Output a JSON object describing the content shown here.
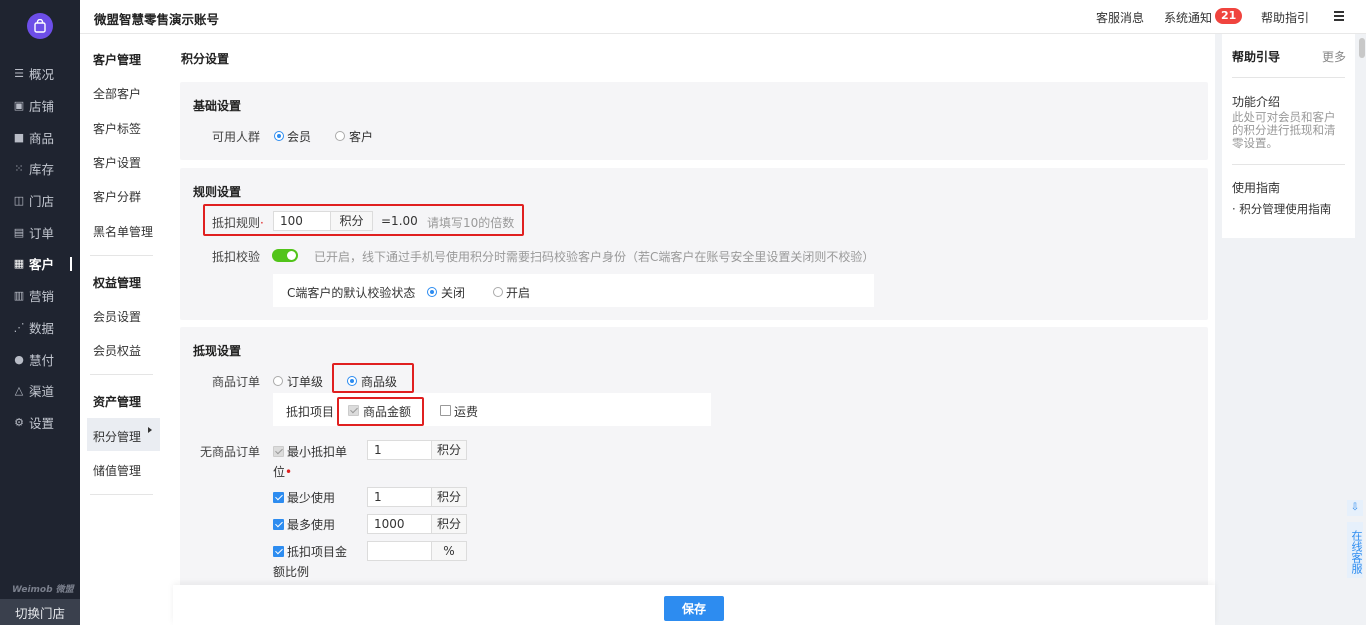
{
  "app": {
    "store_name": "微盟智慧零售演示账号",
    "brand": "Weimob 微盟",
    "switch_store": "切换门店"
  },
  "header": {
    "service_msg": "客服消息",
    "sys_notice": "系统通知",
    "notice_count": "21",
    "help_guide": "帮助指引"
  },
  "nav": {
    "items": [
      {
        "label": "概况",
        "icon": "list-icon"
      },
      {
        "label": "店铺",
        "icon": "store-icon"
      },
      {
        "label": "商品",
        "icon": "goods-icon"
      },
      {
        "label": "库存",
        "icon": "stock-icon"
      },
      {
        "label": "门店",
        "icon": "shop-icon"
      },
      {
        "label": "订单",
        "icon": "order-icon"
      },
      {
        "label": "客户",
        "icon": "customer-icon"
      },
      {
        "label": "营销",
        "icon": "marketing-icon"
      },
      {
        "label": "数据",
        "icon": "data-icon"
      },
      {
        "label": "慧付",
        "icon": "pay-icon"
      },
      {
        "label": "渠道",
        "icon": "channel-icon"
      },
      {
        "label": "设置",
        "icon": "gear-icon"
      }
    ],
    "active": "客户"
  },
  "submenu": {
    "group1": "客户管理",
    "g1_items": [
      "全部客户",
      "客户标签",
      "客户设置",
      "客户分群",
      "黑名单管理"
    ],
    "group2": "权益管理",
    "g2_items": [
      "会员设置",
      "会员权益"
    ],
    "group3": "资产管理",
    "g3_items": [
      "积分管理",
      "储值管理"
    ]
  },
  "page": {
    "title": "积分设置",
    "basic": {
      "title": "基础设置",
      "crowd_label": "可用人群",
      "opt_member": "会员",
      "opt_customer": "客户"
    },
    "rules": {
      "title": "规则设置",
      "deduct_rule_label": "抵扣规则",
      "deduct_value": "100",
      "unit": "积分",
      "equals": "=1.00",
      "deduct_hint": "请填写10的倍数",
      "verify_label": "抵扣校验",
      "verify_desc": "已开启，线下通过手机号使用积分时需要扫码校验客户身份（若C端客户在账号安全里设置关闭则不校验）",
      "c_default_label": "C端客户的默认校验状态",
      "opt_off": "关闭",
      "opt_on": "开启"
    },
    "cash": {
      "title": "抵现设置",
      "goods_order_label": "商品订单",
      "opt_order_level": "订单级",
      "opt_goods_level": "商品级",
      "deduct_items_label": "抵扣项目",
      "item_goods_amount": "商品金额",
      "item_freight": "运费",
      "no_goods_label": "无商品订单",
      "min_unit_l1": "最小抵扣单",
      "min_unit_l2": "位",
      "min_unit_value": "1",
      "min_use_label": "最少使用",
      "min_use_value": "1",
      "max_use_label": "最多使用",
      "max_use_value": "1000",
      "ratio_l1": "抵扣项目金",
      "ratio_l2": "额比例",
      "ratio_value": "",
      "percent": "%"
    },
    "save": "保存"
  },
  "help": {
    "title": "帮助引导",
    "more": "更多",
    "intro_title": "功能介绍",
    "intro_text": "此处可对会员和客户的积分进行抵现和清零设置。",
    "guide_title": "使用指南",
    "guide_link": "· 积分管理使用指南"
  },
  "side_tools": {
    "online_service": "在线客服"
  }
}
